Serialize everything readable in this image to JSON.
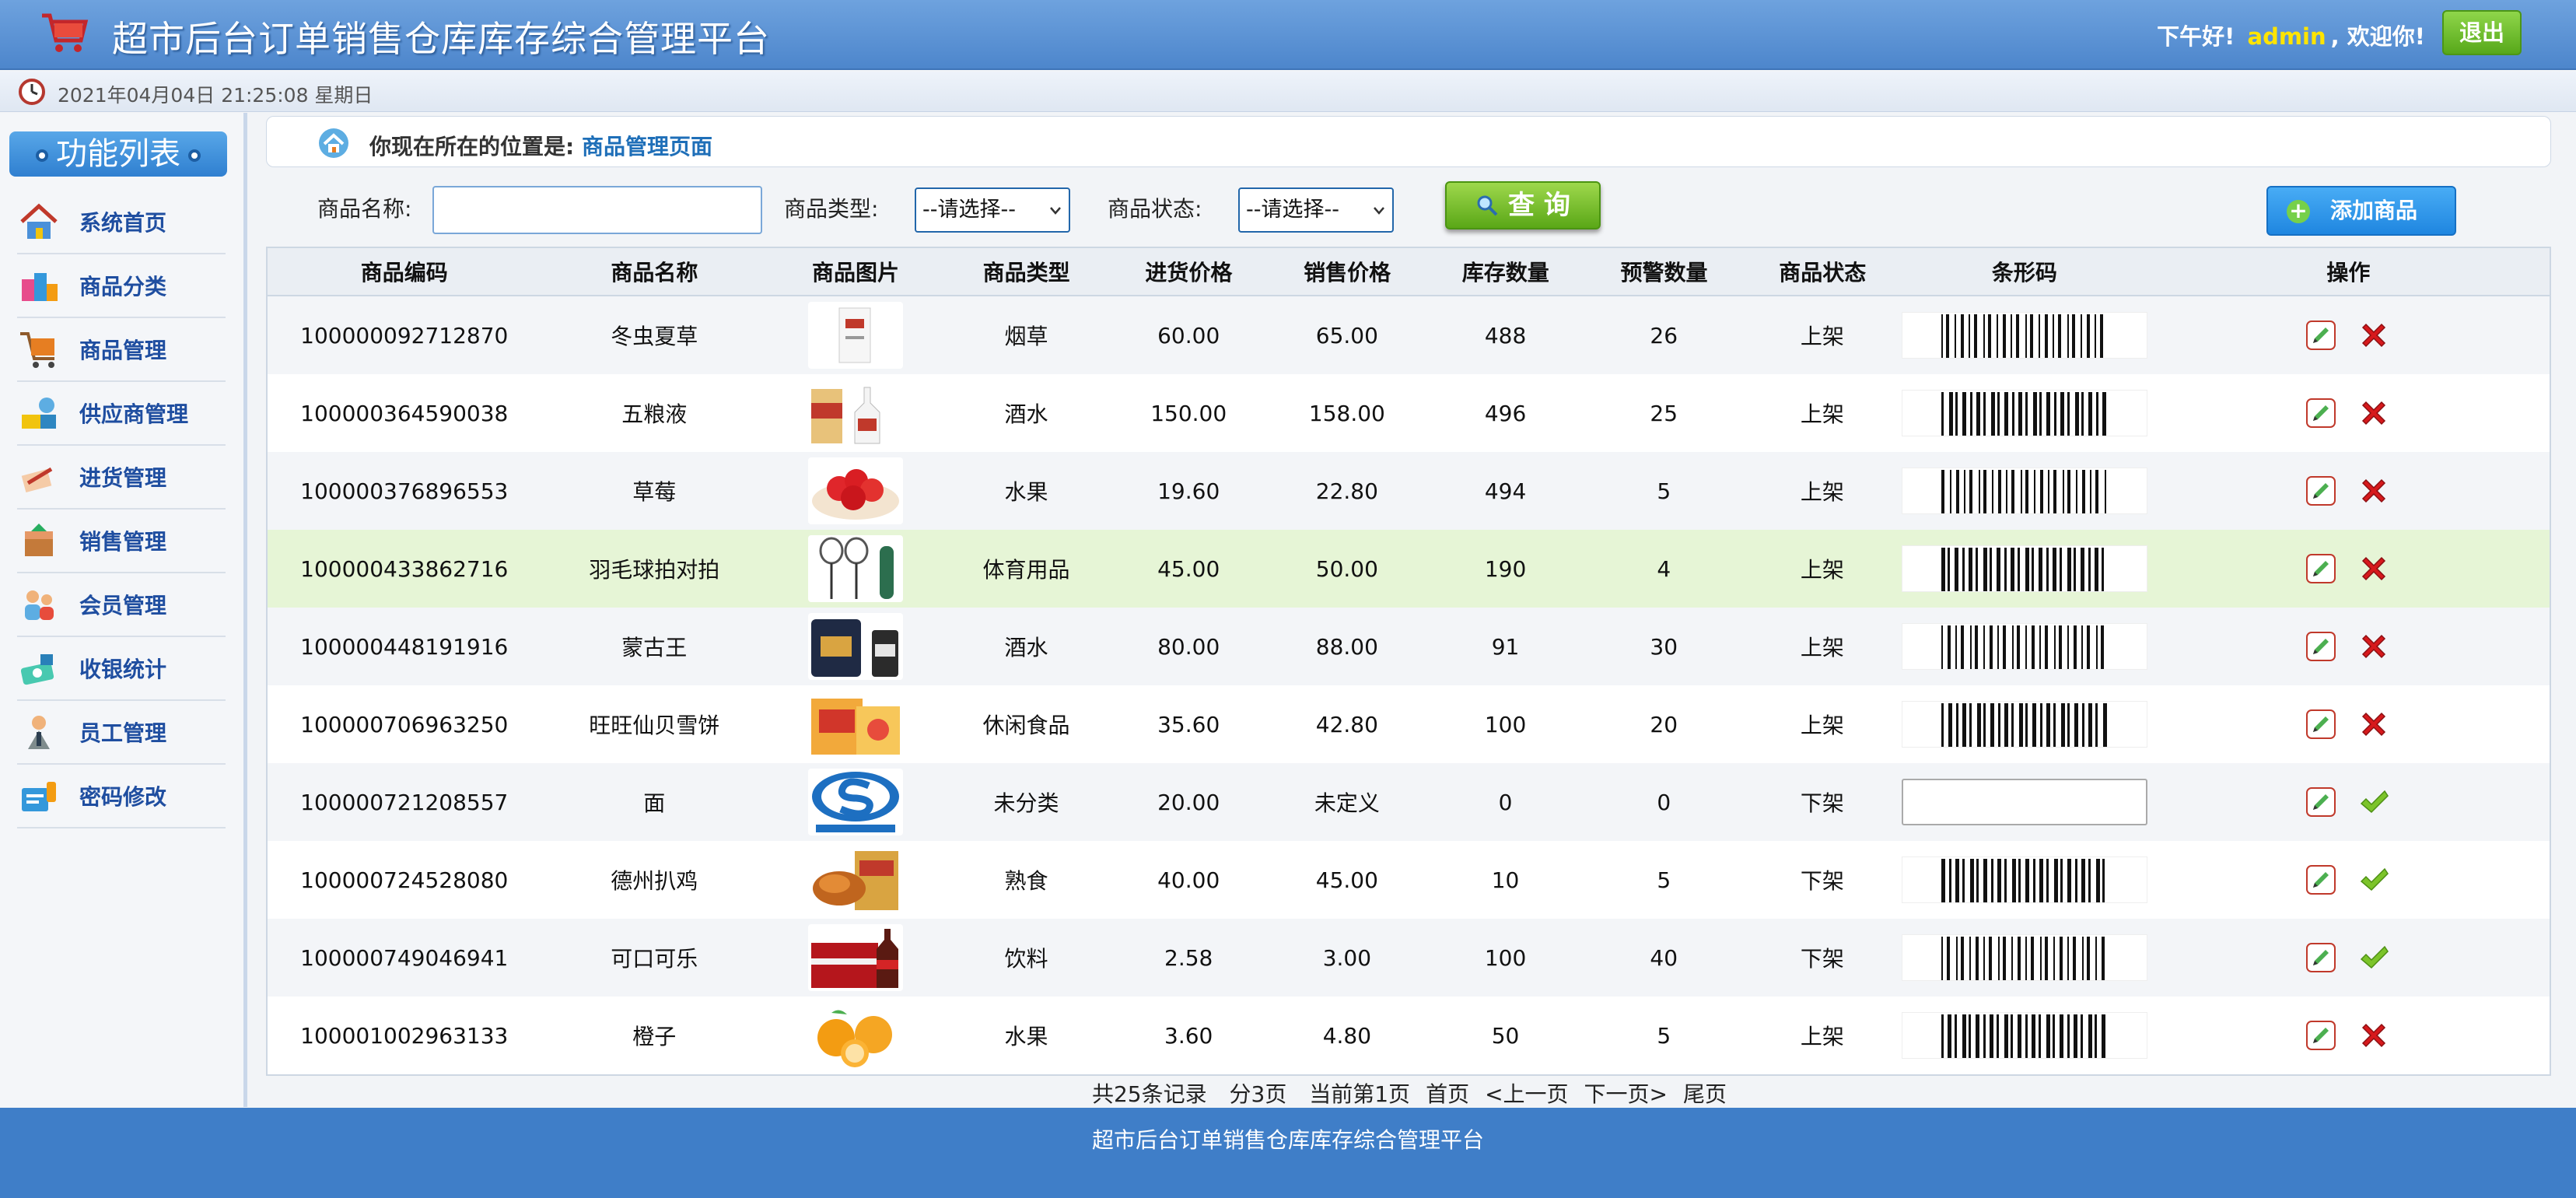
{
  "header": {
    "title": "超市后台订单销售仓库库存综合管理平台",
    "greeting_prefix": "下午好!",
    "username": "admin",
    "greeting_suffix": ", 欢迎你!",
    "logout_label": "退出"
  },
  "datebar": {
    "datetime": "2021年04月04日 21:25:08 星期日"
  },
  "sidebar": {
    "title": "功能列表",
    "items": [
      {
        "label": "系统首页",
        "icon": "home-icon"
      },
      {
        "label": "商品分类",
        "icon": "category-icon"
      },
      {
        "label": "商品管理",
        "icon": "cart-icon"
      },
      {
        "label": "供应商管理",
        "icon": "supplier-icon"
      },
      {
        "label": "进货管理",
        "icon": "purchase-icon"
      },
      {
        "label": "销售管理",
        "icon": "sales-icon"
      },
      {
        "label": "会员管理",
        "icon": "members-icon"
      },
      {
        "label": "收银统计",
        "icon": "cashier-icon"
      },
      {
        "label": "员工管理",
        "icon": "staff-icon"
      },
      {
        "label": "密码修改",
        "icon": "password-icon"
      }
    ]
  },
  "breadcrumb": {
    "prefix": "你现在所在的位置是:",
    "current": "商品管理页面"
  },
  "filter": {
    "name_label": "商品名称:",
    "name_value": "",
    "type_label": "商品类型:",
    "type_selected": "--请选择--",
    "status_label": "商品状态:",
    "status_selected": "--请选择--",
    "query_label": "查 询",
    "add_label": "添加商品"
  },
  "table": {
    "columns": [
      "商品编码",
      "商品名称",
      "商品图片",
      "商品类型",
      "进货价格",
      "销售价格",
      "库存数量",
      "预警数量",
      "商品状态",
      "条形码",
      "操作"
    ],
    "rows": [
      {
        "code": "100000092712870",
        "name": "冬虫夏草",
        "type": "烟草",
        "cost": "60.00",
        "price": "65.00",
        "stock": "488",
        "warn": "26",
        "status": "上架",
        "img": "box-white",
        "barcode": true,
        "action": "delete"
      },
      {
        "code": "100000364590038",
        "name": "五粮液",
        "type": "酒水",
        "cost": "150.00",
        "price": "158.00",
        "stock": "496",
        "warn": "25",
        "status": "上架",
        "img": "liquor-red",
        "barcode": true,
        "action": "delete"
      },
      {
        "code": "100000376896553",
        "name": "草莓",
        "type": "水果",
        "cost": "19.60",
        "price": "22.80",
        "stock": "494",
        "warn": "5",
        "status": "上架",
        "img": "strawberry",
        "barcode": true,
        "action": "delete"
      },
      {
        "code": "100000433862716",
        "name": "羽毛球拍对拍",
        "type": "体育用品",
        "cost": "45.00",
        "price": "50.00",
        "stock": "190",
        "warn": "4",
        "status": "上架",
        "img": "racket",
        "barcode": true,
        "action": "delete"
      },
      {
        "code": "100000448191916",
        "name": "蒙古王",
        "type": "酒水",
        "cost": "80.00",
        "price": "88.00",
        "stock": "91",
        "warn": "30",
        "status": "上架",
        "img": "liquor-dark",
        "barcode": true,
        "action": "delete"
      },
      {
        "code": "100000706963250",
        "name": "旺旺仙贝雪饼",
        "type": "休闲食品",
        "cost": "35.60",
        "price": "42.80",
        "stock": "100",
        "warn": "20",
        "status": "上架",
        "img": "snack",
        "barcode": true,
        "action": "delete"
      },
      {
        "code": "100000721208557",
        "name": "面",
        "type": "未分类",
        "cost": "20.00",
        "price": "未定义",
        "stock": "0",
        "warn": "0",
        "status": "下架",
        "img": "qs-logo",
        "barcode": false,
        "action": "restore"
      },
      {
        "code": "100000724528080",
        "name": "德州扒鸡",
        "type": "熟食",
        "cost": "40.00",
        "price": "45.00",
        "stock": "10",
        "warn": "5",
        "status": "下架",
        "img": "chicken",
        "barcode": true,
        "action": "restore"
      },
      {
        "code": "100000749046941",
        "name": "可口可乐",
        "type": "饮料",
        "cost": "2.58",
        "price": "3.00",
        "stock": "100",
        "warn": "40",
        "status": "下架",
        "img": "cola",
        "barcode": true,
        "action": "restore"
      },
      {
        "code": "100001002963133",
        "name": "橙子",
        "type": "水果",
        "cost": "3.60",
        "price": "4.80",
        "stock": "50",
        "warn": "5",
        "status": "上架",
        "img": "orange",
        "barcode": true,
        "action": "delete"
      }
    ]
  },
  "pager": {
    "total": "共25条记录",
    "pages": "分3页",
    "current": "当前第1页",
    "first": "首页",
    "prev": "<上一页",
    "next": "下一页>",
    "last": "尾页"
  },
  "footer": {
    "text": "超市后台订单销售仓库库存综合管理平台"
  },
  "colors": {
    "header": "#4d86cc",
    "accent_green": "#5aa717",
    "link": "#1f6fb8",
    "highlight_row": "#e6f5d6"
  }
}
